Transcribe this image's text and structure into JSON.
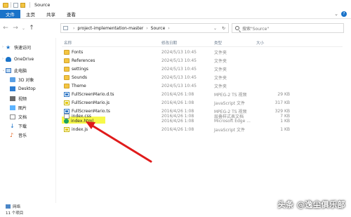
{
  "window": {
    "title": "Source"
  },
  "ribbon": {
    "tabs": [
      "文件",
      "主页",
      "共享",
      "查看"
    ]
  },
  "address": {
    "path": [
      "project-implementation-master",
      "Source"
    ],
    "search_placeholder": "搜索\"Source\""
  },
  "sidebar": {
    "items": [
      {
        "label": "快速访问",
        "icon": "star-icon"
      },
      {
        "label": "OneDrive",
        "icon": "onedrive-icon"
      },
      {
        "label": "此电脑",
        "icon": "computer-icon"
      },
      {
        "label": "3D 对象",
        "icon": "3d-objects-icon"
      },
      {
        "label": "Desktop",
        "icon": "desktop-icon"
      },
      {
        "label": "视频",
        "icon": "video-icon"
      },
      {
        "label": "图片",
        "icon": "pictures-icon"
      },
      {
        "label": "文档",
        "icon": "documents-icon"
      },
      {
        "label": "下载",
        "icon": "download-icon"
      },
      {
        "label": "音乐",
        "icon": "music-icon"
      },
      {
        "label": "网络",
        "icon": "network-icon"
      }
    ]
  },
  "columns": [
    "名称",
    "修改日期",
    "类型",
    "大小"
  ],
  "files": [
    {
      "name": "Fonts",
      "date": "2024/5/13 10:45",
      "type": "文件夹",
      "size": "",
      "icon": "folder-icon"
    },
    {
      "name": "References",
      "date": "2024/5/13 10:45",
      "type": "文件夹",
      "size": "",
      "icon": "folder-icon"
    },
    {
      "name": "settings",
      "date": "2024/5/13 10:45",
      "type": "文件夹",
      "size": "",
      "icon": "folder-icon"
    },
    {
      "name": "Sounds",
      "date": "2024/5/13 10:45",
      "type": "文件夹",
      "size": "",
      "icon": "folder-icon"
    },
    {
      "name": "Theme",
      "date": "2024/5/13 10:45",
      "type": "文件夹",
      "size": "",
      "icon": "folder-icon"
    },
    {
      "name": "FullScreenMario.d.ts",
      "date": "2016/4/26 1:08",
      "type": "MPEG-2 TS 视频",
      "size": "29 KB",
      "icon": "ts-file-icon"
    },
    {
      "name": "FullScreenMario.js",
      "date": "2016/4/26 1:08",
      "type": "JavaScript 文件",
      "size": "317 KB",
      "icon": "js-file-icon"
    },
    {
      "name": "FullScreenMario.ts",
      "date": "2016/4/26 1:08",
      "type": "MPEG-2 TS 视频",
      "size": "329 KB",
      "icon": "ts-file-icon"
    },
    {
      "name": "index.css",
      "date": "2016/4/26 1:08",
      "type": "层叠样式表文档",
      "size": "7 KB",
      "icon": "css-file-icon"
    },
    {
      "name": "index.html",
      "date": "2016/4/26 1:08",
      "type": "Microsoft Edge ...",
      "size": "1 KB",
      "icon": "edge-html-icon"
    },
    {
      "name": "index.js",
      "date": "2016/4/26 1:08",
      "type": "JavaScript 文件",
      "size": "1 KB",
      "icon": "js-file-icon"
    }
  ],
  "status": {
    "network": "网络",
    "count": "11 个项目"
  },
  "watermark": "头条 @逸尘俱乐部",
  "colors": {
    "accent": "#1a73c9",
    "highlight": "#f6f83a",
    "arrow": "#e01b1b"
  }
}
